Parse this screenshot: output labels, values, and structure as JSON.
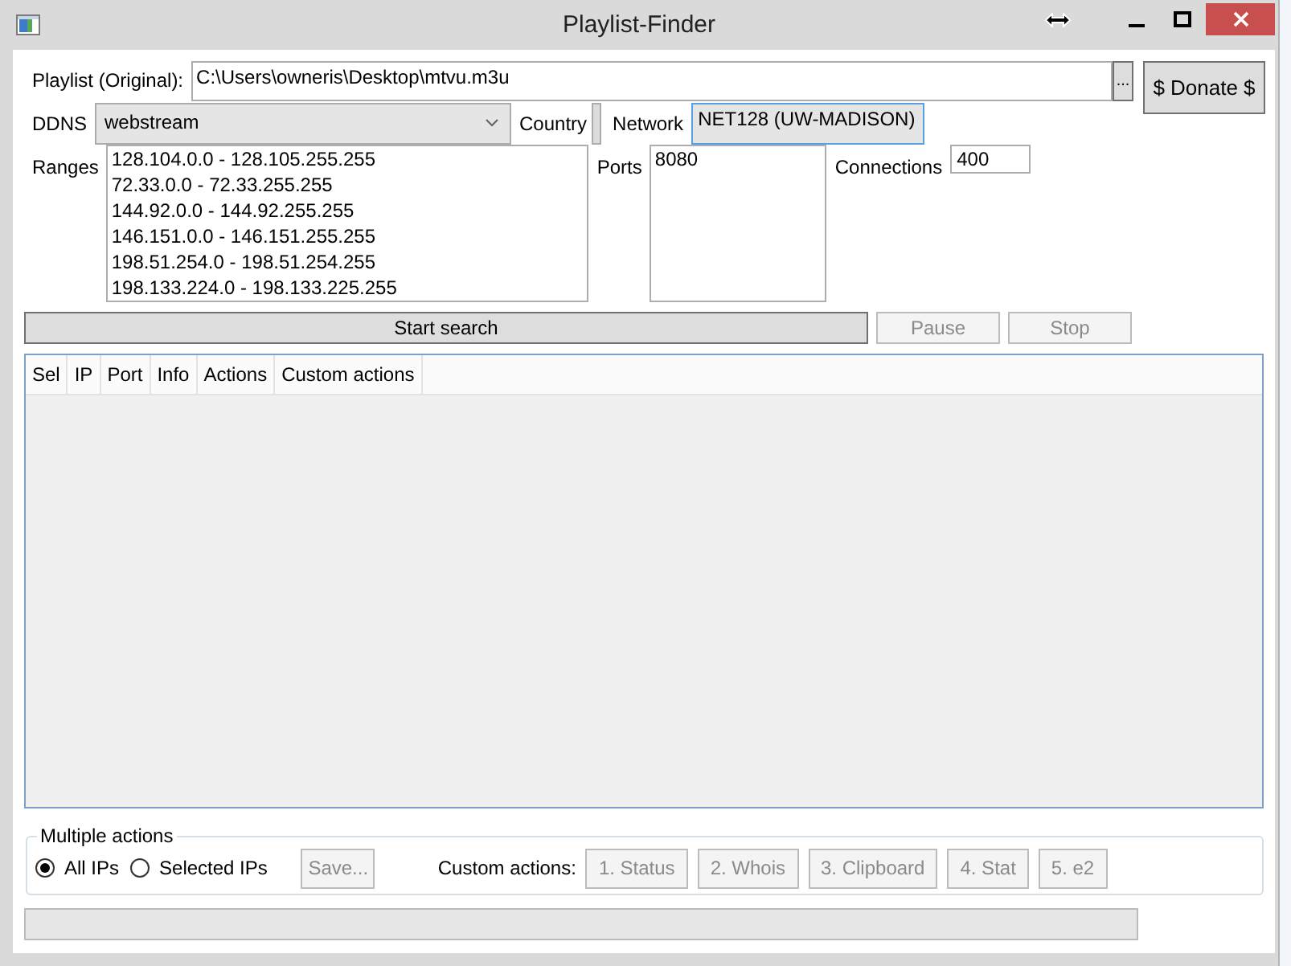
{
  "window": {
    "title": "Playlist-Finder"
  },
  "playlist": {
    "label": "Playlist (Original):",
    "value": "C:\\Users\\owneris\\Desktop\\mtvu.m3u",
    "browse_button": "..."
  },
  "donate_button": "$ Donate $",
  "ddns": {
    "label": "DDNS",
    "value": "webstream"
  },
  "country": {
    "label": "Country"
  },
  "network": {
    "label": "Network",
    "value": "NET128 (UW-MADISON)",
    "focused": true
  },
  "ranges": {
    "label": "Ranges",
    "lines": [
      "128.104.0.0 - 128.105.255.255",
      "72.33.0.0 - 72.33.255.255",
      "144.92.0.0 - 144.92.255.255",
      "146.151.0.0 - 146.151.255.255",
      "198.51.254.0 - 198.51.254.255",
      "198.133.224.0 - 198.133.225.255"
    ]
  },
  "ports": {
    "label": "Ports",
    "lines": [
      "8080"
    ]
  },
  "connections": {
    "label": "Connections",
    "value": "400"
  },
  "search_buttons": [
    {
      "label": "Start search",
      "disabled": false
    },
    {
      "label": "Pause",
      "disabled": true
    },
    {
      "label": "Stop",
      "disabled": true
    }
  ],
  "table": {
    "columns": [
      "Sel",
      "IP",
      "Port",
      "Info",
      "Actions",
      "Custom actions"
    ]
  },
  "multiple_actions": {
    "title": "Multiple actions",
    "scope": [
      {
        "label": "All IPs",
        "selected": true
      },
      {
        "label": "Selected IPs",
        "selected": false
      }
    ],
    "save_button": {
      "label": "Save...",
      "disabled": true
    },
    "custom_actions_label": "Custom actions:",
    "custom_actions": [
      {
        "label": "1. Status",
        "disabled": true
      },
      {
        "label": "2. Whois",
        "disabled": true
      },
      {
        "label": "3. Clipboard",
        "disabled": true
      },
      {
        "label": "4. Stat",
        "disabled": true
      },
      {
        "label": "5. e2",
        "disabled": true
      }
    ]
  },
  "progress": {
    "level": 0
  }
}
